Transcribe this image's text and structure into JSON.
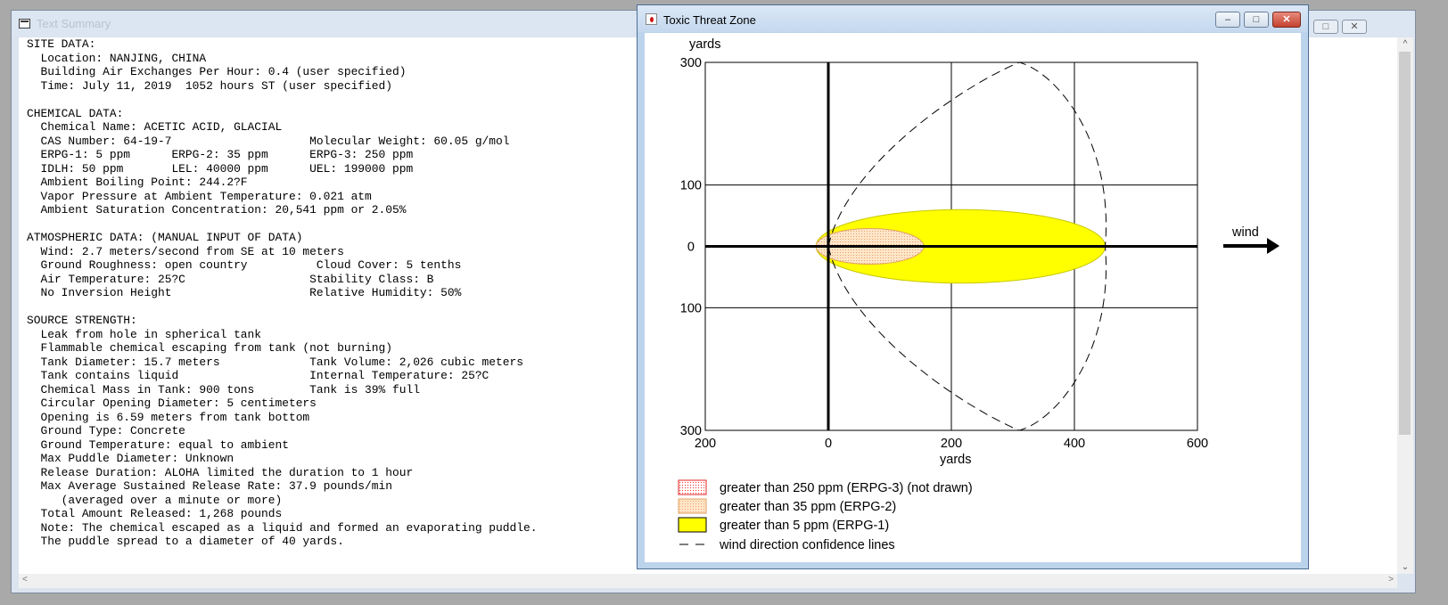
{
  "text_window": {
    "title": "Text Summary",
    "lines": [
      "SITE DATA:",
      "  Location: NANJING, CHINA",
      "  Building Air Exchanges Per Hour: 0.4 (user specified)",
      "  Time: July 11, 2019  1052 hours ST (user specified)",
      "",
      "CHEMICAL DATA:",
      "  Chemical Name: ACETIC ACID, GLACIAL",
      "  CAS Number: 64-19-7                    Molecular Weight: 60.05 g/mol",
      "  ERPG-1: 5 ppm      ERPG-2: 35 ppm      ERPG-3: 250 ppm",
      "  IDLH: 50 ppm       LEL: 40000 ppm      UEL: 199000 ppm",
      "  Ambient Boiling Point: 244.2?F",
      "  Vapor Pressure at Ambient Temperature: 0.021 atm",
      "  Ambient Saturation Concentration: 20,541 ppm or 2.05%",
      "",
      "ATMOSPHERIC DATA: (MANUAL INPUT OF DATA)",
      "  Wind: 2.7 meters/second from SE at 10 meters",
      "  Ground Roughness: open country          Cloud Cover: 5 tenths",
      "  Air Temperature: 25?C                  Stability Class: B",
      "  No Inversion Height                    Relative Humidity: 50%",
      "",
      "SOURCE STRENGTH:",
      "  Leak from hole in spherical tank",
      "  Flammable chemical escaping from tank (not burning)",
      "  Tank Diameter: 15.7 meters             Tank Volume: 2,026 cubic meters",
      "  Tank contains liquid                   Internal Temperature: 25?C",
      "  Chemical Mass in Tank: 900 tons        Tank is 39% full",
      "  Circular Opening Diameter: 5 centimeters",
      "  Opening is 6.59 meters from tank bottom",
      "  Ground Type: Concrete",
      "  Ground Temperature: equal to ambient",
      "  Max Puddle Diameter: Unknown",
      "  Release Duration: ALOHA limited the duration to 1 hour",
      "  Max Average Sustained Release Rate: 37.9 pounds/min",
      "     (averaged over a minute or more)",
      "  Total Amount Released: 1,268 pounds",
      "  Note: The chemical escaped as a liquid and formed an evaporating puddle.",
      "  The puddle spread to a diameter of 40 yards."
    ]
  },
  "threat_window": {
    "title": "Toxic Threat Zone",
    "wind_label": "wind",
    "legend": [
      {
        "label": "greater than 250 ppm (ERPG-3) (not drawn)",
        "swatch": "red-dotted",
        "color": "#ff4040"
      },
      {
        "label": "greater than 35 ppm (ERPG-2)",
        "swatch": "orange-dotted",
        "color": "#ffd4a8"
      },
      {
        "label": "greater than 5 ppm (ERPG-1)",
        "swatch": "yellow",
        "color": "#ffff00"
      },
      {
        "label": "wind direction confidence lines",
        "swatch": "dash"
      }
    ]
  },
  "chart_data": {
    "type": "area",
    "xlabel": "yards",
    "ylabel": "yards",
    "x_ticks": [
      "200",
      "0",
      "200",
      "400",
      "600"
    ],
    "y_ticks": [
      "300",
      "100",
      "0",
      "100",
      "300"
    ],
    "x_range": [
      -200,
      600
    ],
    "y_range": [
      -300,
      300
    ],
    "grid": true,
    "zones": [
      {
        "name": "ERPG-2 (>35 ppm)",
        "x_start": -20,
        "x_end": 155,
        "half_width": 29,
        "color": "#ffdfba"
      },
      {
        "name": "ERPG-1 (>5 ppm)",
        "x_start": -20,
        "x_end": 450,
        "half_width": 60,
        "color": "#ffff00"
      }
    ],
    "confidence_lines": {
      "x_start": 0,
      "x_max": 450,
      "y_max": 300
    }
  }
}
